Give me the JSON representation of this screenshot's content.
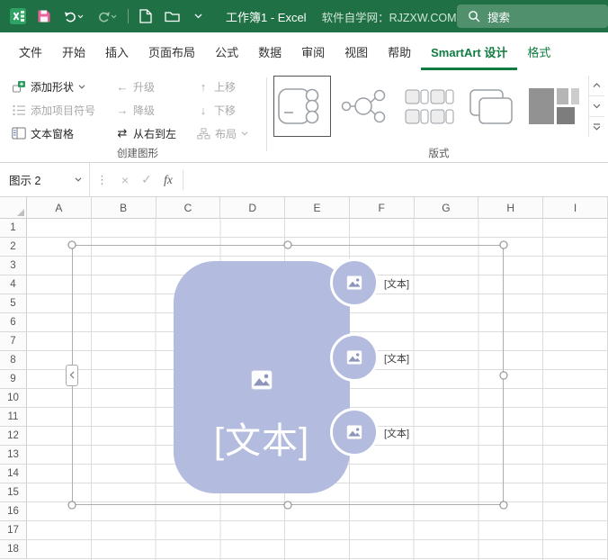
{
  "title_bar": {
    "workbook_title": "工作簿1 - Excel",
    "site_text": "软件自学网：RJZXW.COM",
    "search_label": "搜索"
  },
  "ribbon": {
    "tabs": [
      {
        "id": "file",
        "label": "文件"
      },
      {
        "id": "home",
        "label": "开始"
      },
      {
        "id": "insert",
        "label": "插入"
      },
      {
        "id": "page-layout",
        "label": "页面布局"
      },
      {
        "id": "formulas",
        "label": "公式"
      },
      {
        "id": "data",
        "label": "数据"
      },
      {
        "id": "review",
        "label": "审阅"
      },
      {
        "id": "view",
        "label": "视图"
      },
      {
        "id": "help",
        "label": "帮助"
      },
      {
        "id": "smartart-design",
        "label": "SmartArt 设计",
        "active": true
      },
      {
        "id": "format",
        "label": "格式",
        "accent": true
      }
    ],
    "create_graphic": {
      "group_label": "创建图形",
      "add_shape": "添加形状",
      "add_bullet": "添加项目符号",
      "text_pane": "文本窗格",
      "promote": "升级",
      "demote": "降级",
      "move_up": "上移",
      "move_down": "下移",
      "right_to_left": "从右到左",
      "layout": "布局"
    },
    "layouts": {
      "group_label": "版式"
    }
  },
  "formula_bar": {
    "name_box_value": "图示 2",
    "cancel_glyph": "×",
    "enter_glyph": "✓",
    "fx_glyph": "fx",
    "dots_glyph": "⋮"
  },
  "grid": {
    "columns": [
      "A",
      "B",
      "C",
      "D",
      "E",
      "F",
      "G",
      "H",
      "I"
    ],
    "rows": [
      "1",
      "2",
      "3",
      "4",
      "5",
      "6",
      "7",
      "8",
      "9",
      "10",
      "11",
      "12",
      "13",
      "14",
      "15",
      "16",
      "17",
      "18"
    ]
  },
  "smartart": {
    "main_placeholder": "[文本]",
    "item_placeholders": [
      "[文本]",
      "[文本]",
      "[文本]"
    ]
  },
  "glyphs": {
    "promote_arrow": "←",
    "demote_arrow": "→",
    "move_up_arrow": "↑",
    "move_down_arrow": "↓",
    "right_to_left_arrow": "⇄"
  },
  "colors": {
    "titlebar_green": "#1f7145",
    "accent_green": "#107c41",
    "smartart_fill": "#b3bbdf"
  }
}
